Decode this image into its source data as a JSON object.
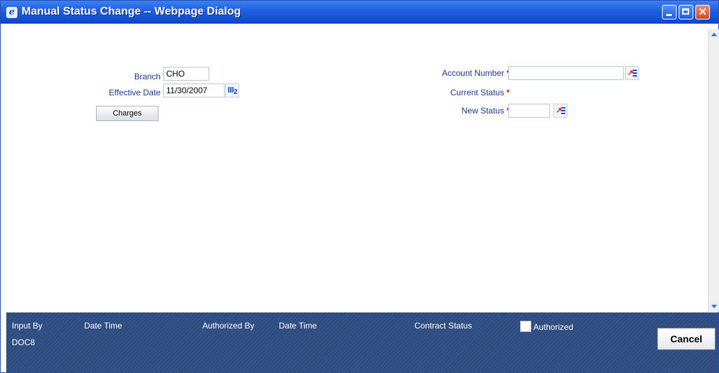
{
  "window": {
    "title": "Manual Status Change -- Webpage Dialog"
  },
  "form": {
    "branch_label": "Branch",
    "branch_value": "CHO",
    "effective_date_label": "Effective Date",
    "effective_date_value": "11/30/2007",
    "charges_label": "Charges",
    "account_number_label": "Account Number",
    "account_number_value": "",
    "current_status_label": "Current Status",
    "new_status_label": "New Status",
    "new_status_value": "",
    "required_mark": "*"
  },
  "footer": {
    "input_by_label": "Input By",
    "input_by_value": "DOC8",
    "date_time_label": "Date Time",
    "authorized_by_label": "Authorized By",
    "date_time_label_2": "Date Time",
    "contract_status_label": "Contract Status",
    "authorized_label": "Authorized",
    "authorized_checked": false,
    "cancel_label": "Cancel"
  },
  "icons": {
    "window": "ie-icon",
    "lov": "list-of-values-icon",
    "calendar": "calendar-icon"
  },
  "colors": {
    "titlebar": "#1d5fe0",
    "label": "#1b3a8e",
    "required": "#e21b1b",
    "footer": "#2e4b7c"
  }
}
